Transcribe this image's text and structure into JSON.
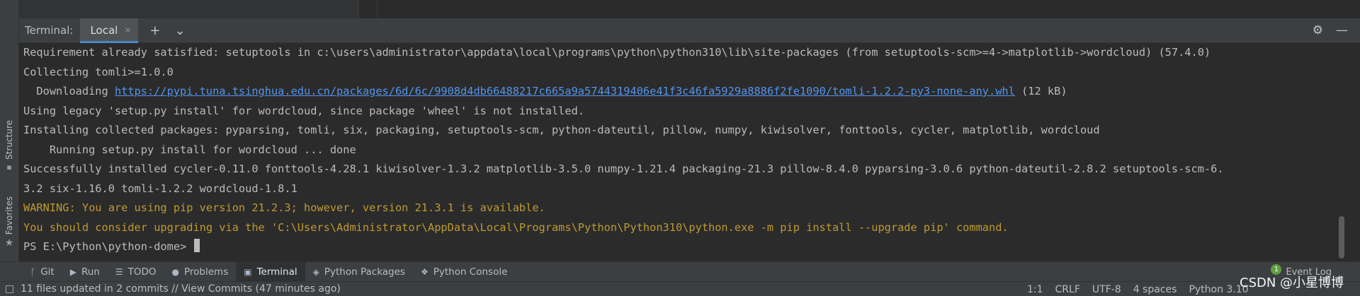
{
  "left_strip": {
    "structure_label": "Structure",
    "favorites_label": "Favorites"
  },
  "terminal": {
    "title": "Terminal:",
    "tab_label": "Local",
    "lines": {
      "l1": "Requirement already satisfied: setuptools in c:\\users\\administrator\\appdata\\local\\programs\\python\\python310\\lib\\site-packages (from setuptools-scm>=4->matplotlib->wordcloud) (57.4.0)",
      "l2": "Collecting tomli>=1.0.0",
      "l3_prefix": "  Downloading ",
      "l3_link": "https://pypi.tuna.tsinghua.edu.cn/packages/6d/6c/9908d4db66488217c665a9a5744319406e41f3c46fa5929a8886f2fe1090/tomli-1.2.2-py3-none-any.whl",
      "l3_suffix": " (12 kB)",
      "l4": "Using legacy 'setup.py install' for wordcloud, since package 'wheel' is not installed.",
      "l5": "Installing collected packages: pyparsing, tomli, six, packaging, setuptools-scm, python-dateutil, pillow, numpy, kiwisolver, fonttools, cycler, matplotlib, wordcloud",
      "l6": "    Running setup.py install for wordcloud ... done",
      "l7": "Successfully installed cycler-0.11.0 fonttools-4.28.1 kiwisolver-1.3.2 matplotlib-3.5.0 numpy-1.21.4 packaging-21.3 pillow-8.4.0 pyparsing-3.0.6 python-dateutil-2.8.2 setuptools-scm-6.",
      "l8": "3.2 six-1.16.0 tomli-1.2.2 wordcloud-1.8.1",
      "l9": "WARNING: You are using pip version 21.2.3; however, version 21.3.1 is available.",
      "l10": "You should consider upgrading via the 'C:\\Users\\Administrator\\AppData\\Local\\Programs\\Python\\Python310\\python.exe -m pip install --upgrade pip' command.",
      "prompt": "PS E:\\Python\\python-dome> "
    },
    "colors": {
      "link": "#5394ec",
      "warning": "#bf9a31",
      "accent": "#4a88c7"
    }
  },
  "tool_windows": {
    "git": "Git",
    "run": "Run",
    "todo": "TODO",
    "problems": "Problems",
    "terminal": "Terminal",
    "python_packages": "Python Packages",
    "python_console": "Python Console",
    "event_log": "Event Log",
    "event_count": "1"
  },
  "status_bar": {
    "message": "11 files updated in 2 commits // View Commits (47 minutes ago)",
    "position": "1:1",
    "line_sep": "CRLF",
    "encoding": "UTF-8",
    "indent": "4 spaces",
    "interpreter": "Python 3.10"
  },
  "watermark": "CSDN @小星博博"
}
